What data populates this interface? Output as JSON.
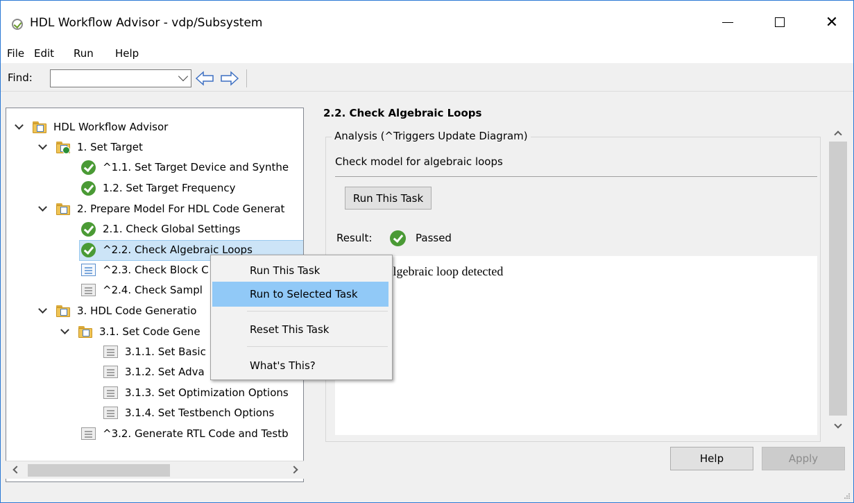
{
  "window": {
    "title": "HDL Workflow Advisor - vdp/Subsystem",
    "controls": [
      "minimize",
      "maximize",
      "close"
    ]
  },
  "menubar": {
    "items": [
      "File",
      "Edit",
      "Run",
      "Help"
    ]
  },
  "toolbar": {
    "find_label": "Find:",
    "find_value": "",
    "back_icon": "left-arrow-icon",
    "forward_icon": "right-arrow-icon"
  },
  "tree": {
    "items": [
      {
        "label": "HDL Workflow Advisor",
        "level": 0,
        "icon": "folder-icon",
        "expanded": true
      },
      {
        "label": "1. Set Target",
        "level": 1,
        "icon": "folder-check-icon",
        "expanded": true
      },
      {
        "label": "^1.1. Set Target Device and Synthe",
        "level": 2,
        "icon": "check-icon"
      },
      {
        "label": "1.2. Set Target Frequency",
        "level": 2,
        "icon": "check-icon"
      },
      {
        "label": "2. Prepare Model For HDL Code Generat",
        "level": 1,
        "icon": "folder-icon",
        "expanded": true
      },
      {
        "label": "2.1. Check Global Settings",
        "level": 2,
        "icon": "check-icon"
      },
      {
        "label": "^2.2. Check Algebraic Loops",
        "level": 2,
        "icon": "check-icon",
        "selected": true
      },
      {
        "label": "^2.3. Check Block C",
        "level": 2,
        "icon": "task-blue-icon"
      },
      {
        "label": "^2.4. Check Sampl",
        "level": 2,
        "icon": "task-icon"
      },
      {
        "label": "3. HDL Code Generatio",
        "level": 1,
        "icon": "folder-icon",
        "expanded": true
      },
      {
        "label": "3.1. Set Code Gene",
        "level": 2,
        "icon": "folder-icon",
        "expanded": true
      },
      {
        "label": "3.1.1. Set Basic",
        "level": 3,
        "icon": "task-icon"
      },
      {
        "label": "3.1.2. Set Adva",
        "level": 3,
        "icon": "task-icon"
      },
      {
        "label": "3.1.3. Set Optimization Options",
        "level": 3,
        "icon": "task-icon"
      },
      {
        "label": "3.1.4. Set Testbench Options",
        "level": 3,
        "icon": "task-icon"
      },
      {
        "label": "^3.2. Generate RTL Code and Testb",
        "level": 2,
        "icon": "task-icon"
      }
    ]
  },
  "detail": {
    "title": "2.2. Check Algebraic Loops",
    "group_label": "Analysis (^Triggers Update Diagram)",
    "description": "Check model for algebraic loops",
    "run_button": "Run This Task",
    "result_label": "Result:",
    "result_status": "Passed",
    "result_message": "No algebraic loop detected"
  },
  "footer": {
    "help_button": "Help",
    "apply_button": "Apply"
  },
  "context_menu": {
    "items": [
      {
        "label": "Run This Task",
        "highlighted": false
      },
      {
        "label": "Run to Selected Task",
        "highlighted": true
      },
      {
        "label": "Reset This Task",
        "highlighted": false
      },
      {
        "label": "What's This?",
        "highlighted": false
      }
    ]
  },
  "colors": {
    "selection": "#cce4f7",
    "menu_highlight": "#91c9f7",
    "pass_green": "#4a9a35"
  }
}
